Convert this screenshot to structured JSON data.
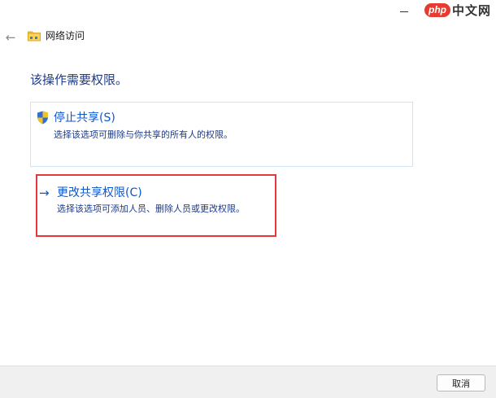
{
  "window": {
    "title": "网络访问"
  },
  "watermark": {
    "logo": "php",
    "text": "中文网"
  },
  "icons": {
    "back": "back-arrow-icon",
    "folder": "network-folder-icon",
    "shield": "uac-shield-icon",
    "arrow": "right-arrow-icon",
    "minimize": "minimize-icon"
  },
  "page": {
    "heading": "该操作需要权限。"
  },
  "options": [
    {
      "title": "停止共享(S)",
      "description": "选择该选项可删除与你共享的所有人的权限。"
    },
    {
      "title": "更改共享权限(C)",
      "description": "选择该选项可添加人员、删除人员或更改权限。"
    }
  ],
  "footer": {
    "cancel_label": "取消"
  },
  "colors": {
    "link_blue": "#0b57d0",
    "desc_blue": "#1a3a8a",
    "highlight_red": "#e4383f",
    "card_border": "#cfe4f4",
    "footer_bg": "#f0f0f0"
  }
}
